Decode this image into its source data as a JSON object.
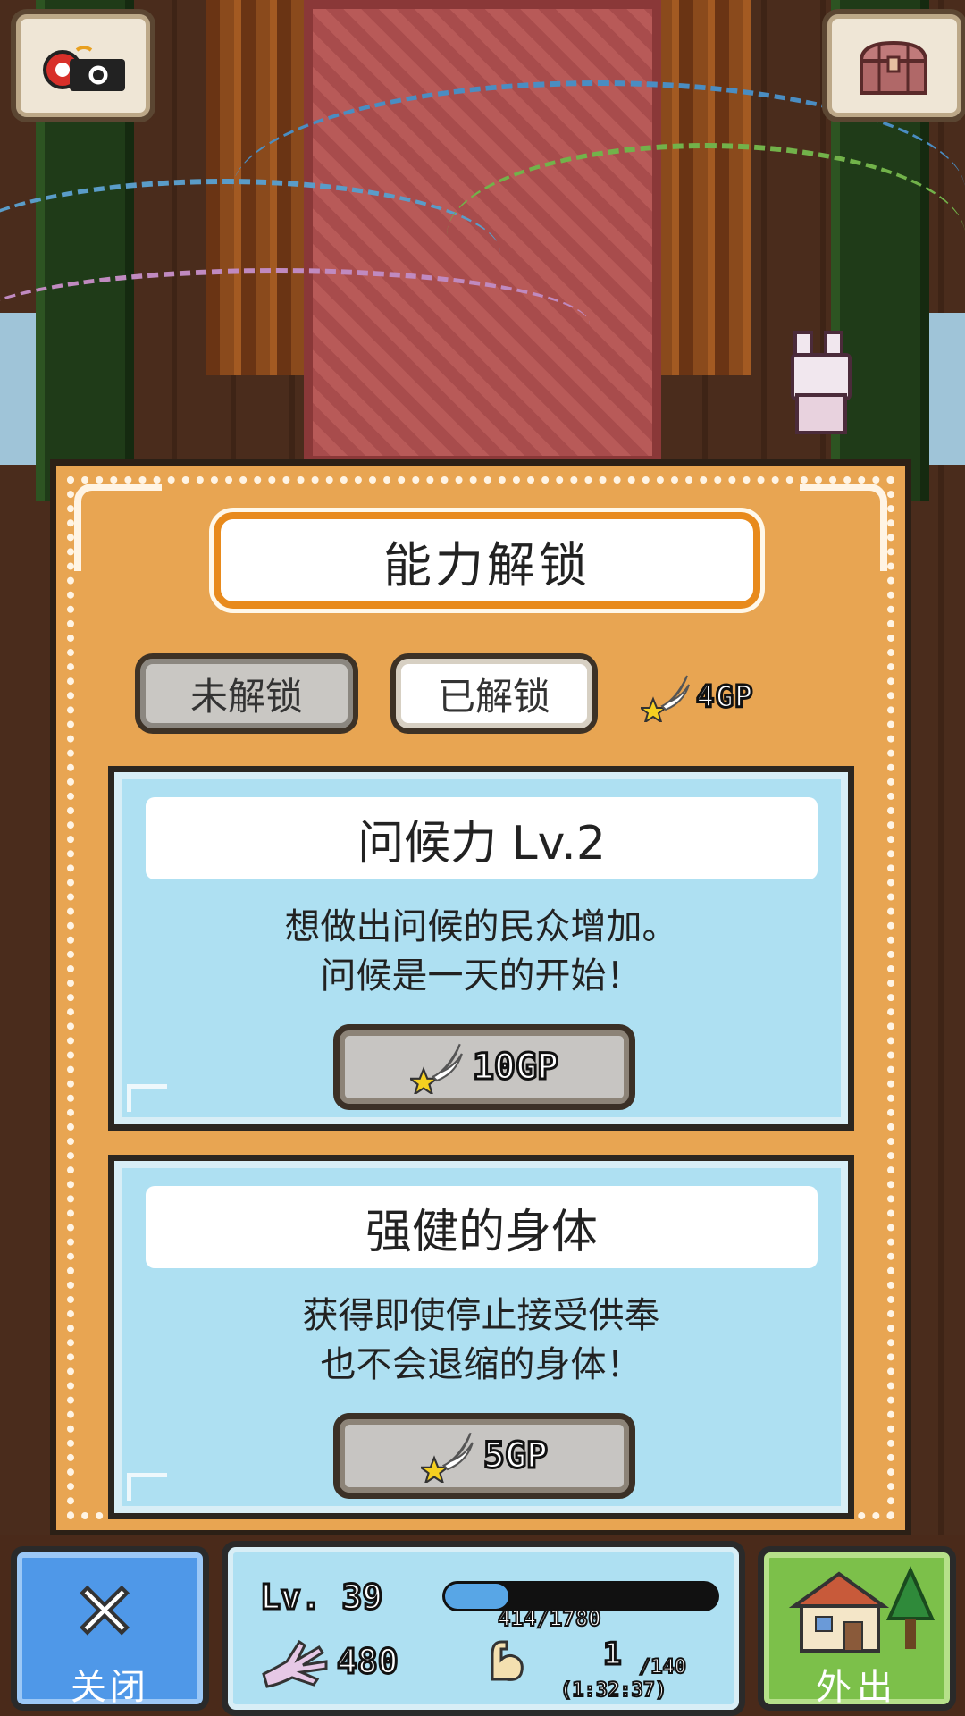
{
  "top_bar": {
    "left_icon": "camera-icon",
    "right_icon": "treasure-chest-icon"
  },
  "panel": {
    "title": "能力解锁",
    "tabs": [
      {
        "label": "未解锁",
        "state": "inactive"
      },
      {
        "label": "已解锁",
        "state": "active"
      }
    ],
    "gp_total": "4GP",
    "cards": [
      {
        "title": "问候力 Lv.2",
        "desc_lines": [
          "想做出问候的民众增加。",
          "问候是一天的开始！"
        ],
        "cost": "10GP"
      },
      {
        "title": "强健的身体",
        "desc_lines": [
          "获得即使停止接受供奉",
          "也不会退缩的身体！"
        ],
        "cost": "5GP"
      }
    ]
  },
  "bottom_bar": {
    "close_label": "关闭",
    "level": "Lv. 39",
    "xp_text": "414/1780",
    "xp_progress": 0.2326,
    "hands_count": "480",
    "strength_current": "1",
    "strength_max": "/140",
    "timer": "(1:32:37)",
    "out_label": "外出"
  },
  "colors": {
    "panel_orange": "#e8a552",
    "card_blue": "#aee0f2",
    "close_blue": "#4f98e8",
    "out_green": "#7cc04a",
    "title_border": "#e88a1c"
  }
}
